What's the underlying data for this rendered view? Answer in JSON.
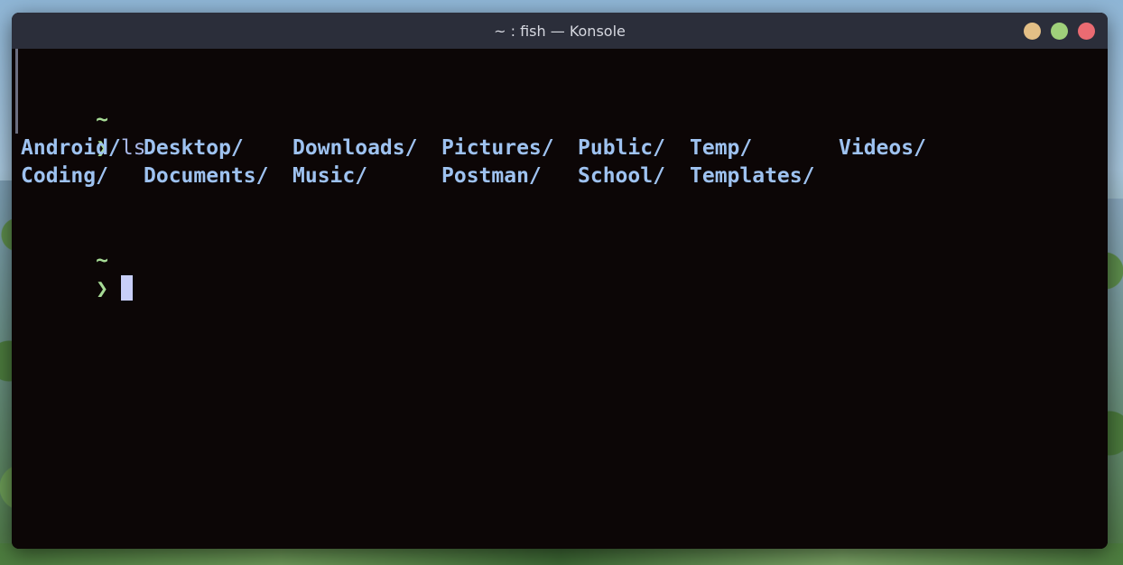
{
  "window": {
    "title": "~ : fish — Konsole",
    "controls": {
      "minimize_color": "#e3bf86",
      "maximize_color": "#9fd07a",
      "close_color": "#ea6b72"
    }
  },
  "terminal": {
    "prompt_dir_1": "~",
    "prompt_symbol_1": "❯",
    "command_1": "ls",
    "ls_output": {
      "row1": [
        "Android/",
        "Desktop/",
        "Downloads/",
        "Pictures/",
        "Public/",
        "Temp/",
        "Videos/"
      ],
      "row2": [
        "Coding/",
        "Documents/",
        "Music/",
        "Postman/",
        "School/",
        "Templates/"
      ]
    },
    "prompt_dir_2": "~",
    "prompt_symbol_2": "❯",
    "colors": {
      "background": "#0c0606",
      "prompt": "#a6da95",
      "directory": "#9ec2f0",
      "cursor": "#c8cef8"
    }
  }
}
